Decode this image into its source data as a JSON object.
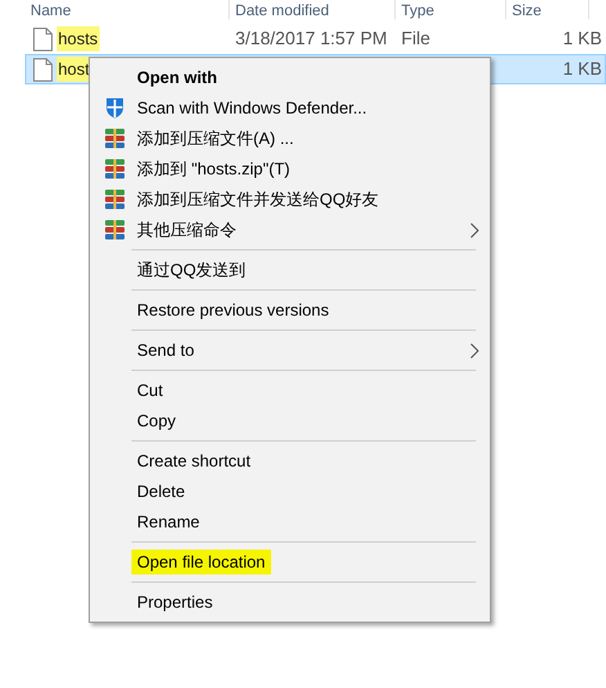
{
  "columns": [
    "Name",
    "Date modified",
    "Type",
    "Size"
  ],
  "files": [
    {
      "name": "hosts",
      "date": "3/18/2017 1:57 PM",
      "type": "File",
      "size": "1 KB",
      "selected": false,
      "highlighted": true
    },
    {
      "name": "host",
      "size": "1 KB",
      "selected": true,
      "highlighted": true
    }
  ],
  "context_menu": [
    {
      "kind": "item",
      "label": "Open with",
      "bold": true
    },
    {
      "kind": "shield",
      "label": "Scan with Windows Defender..."
    },
    {
      "kind": "archive",
      "label": "添加到压缩文件(A) ..."
    },
    {
      "kind": "archive",
      "label": "添加到 \"hosts.zip\"(T)"
    },
    {
      "kind": "archive",
      "label": "添加到压缩文件并发送给QQ好友"
    },
    {
      "kind": "archive",
      "label": "其他压缩命令",
      "submenu": true
    },
    {
      "kind": "separator"
    },
    {
      "kind": "item",
      "label": "通过QQ发送到"
    },
    {
      "kind": "separator"
    },
    {
      "kind": "item",
      "label": "Restore previous versions"
    },
    {
      "kind": "separator"
    },
    {
      "kind": "item",
      "label": "Send to",
      "submenu": true
    },
    {
      "kind": "separator"
    },
    {
      "kind": "item",
      "label": "Cut"
    },
    {
      "kind": "item",
      "label": "Copy"
    },
    {
      "kind": "separator"
    },
    {
      "kind": "item",
      "label": "Create shortcut"
    },
    {
      "kind": "item",
      "label": "Delete"
    },
    {
      "kind": "item",
      "label": "Rename"
    },
    {
      "kind": "separator"
    },
    {
      "kind": "item",
      "label": "Open file location",
      "highlighted": true
    },
    {
      "kind": "separator"
    },
    {
      "kind": "item",
      "label": "Properties"
    }
  ]
}
